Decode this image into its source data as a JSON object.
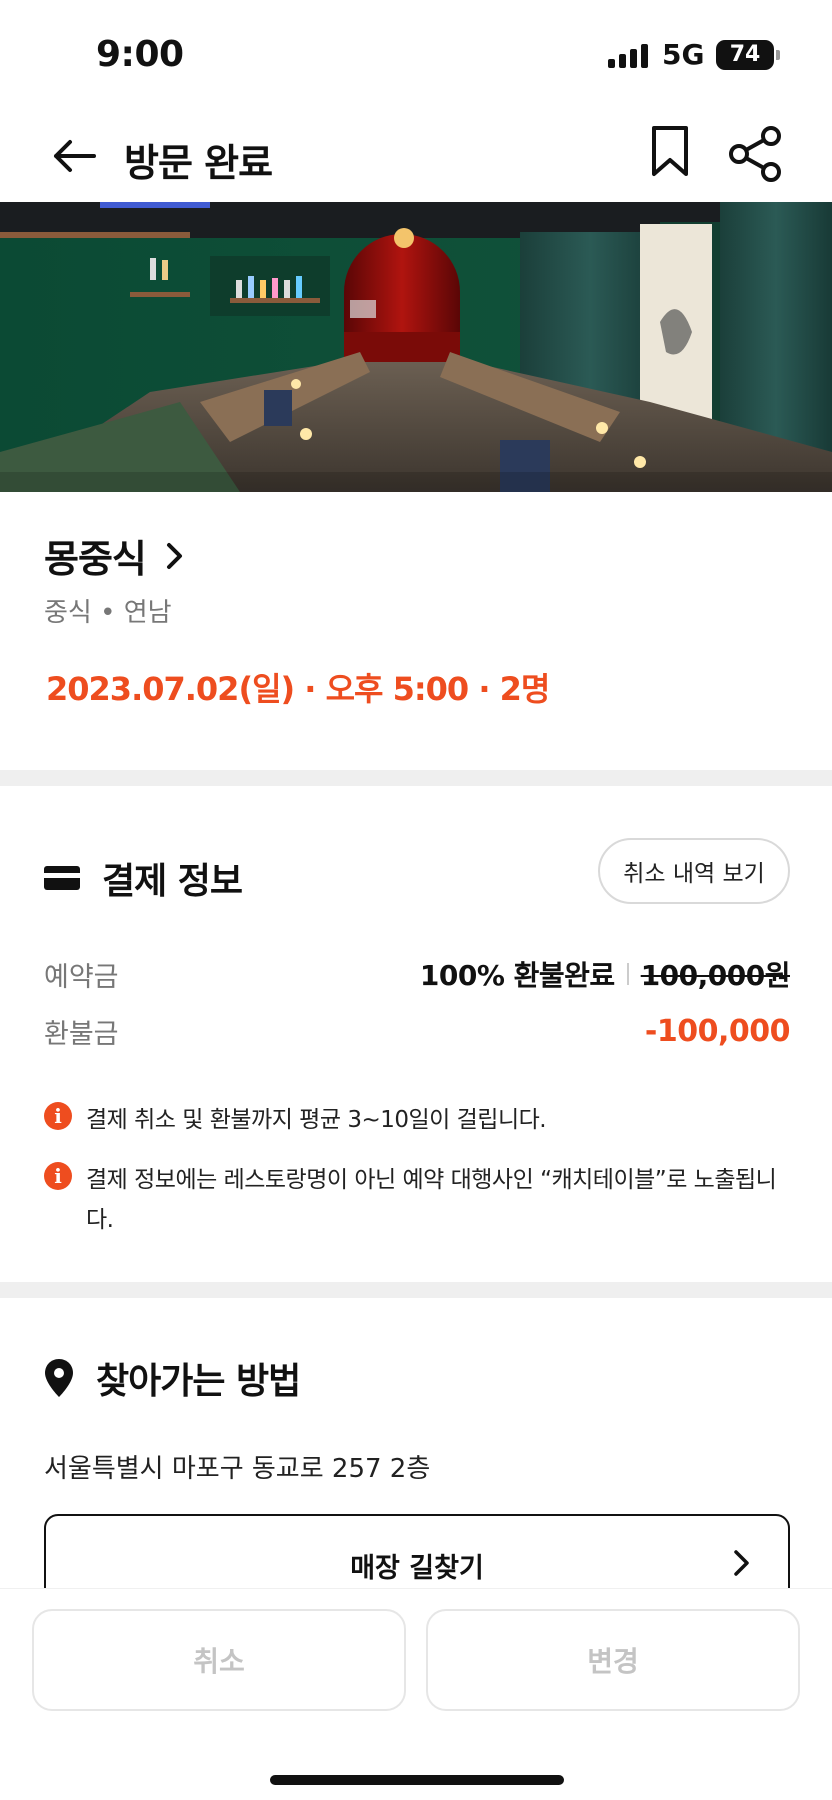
{
  "status_bar": {
    "time": "9:00",
    "network": "5G",
    "battery": "74"
  },
  "nav": {
    "title": "방문 완료",
    "back_icon": "arrow-left-icon",
    "bookmark_icon": "bookmark-icon",
    "share_icon": "share-icon"
  },
  "restaurant": {
    "name": "몽중식",
    "meta": "중식 • 연남",
    "booking": "2023.07.02(일) · 오후 5:00 · 2명"
  },
  "payment": {
    "title": "결제 정보",
    "cancel_history_label": "취소 내역 보기",
    "deposit_label": "예약금",
    "deposit_status": "100% 환불완료",
    "deposit_original": "100,000원",
    "refund_label": "환불금",
    "refund_value": "-100,000",
    "notices": [
      "결제 취소 및 환불까지 평균 3~10일이 걸립니다.",
      "결제 정보에는 레스토랑명이 아닌 예약 대행사인 “캐치테이블”로 노출됩니다."
    ]
  },
  "directions": {
    "title": "찾아가는 방법",
    "address": "서울특별시 마포구 동교로 257 2층",
    "route_button": "매장 길찾기"
  },
  "bottom": {
    "cancel_label": "취소",
    "change_label": "변경"
  },
  "colors": {
    "accent": "#ee4d1f",
    "disabled_text": "#c4c4c4"
  }
}
